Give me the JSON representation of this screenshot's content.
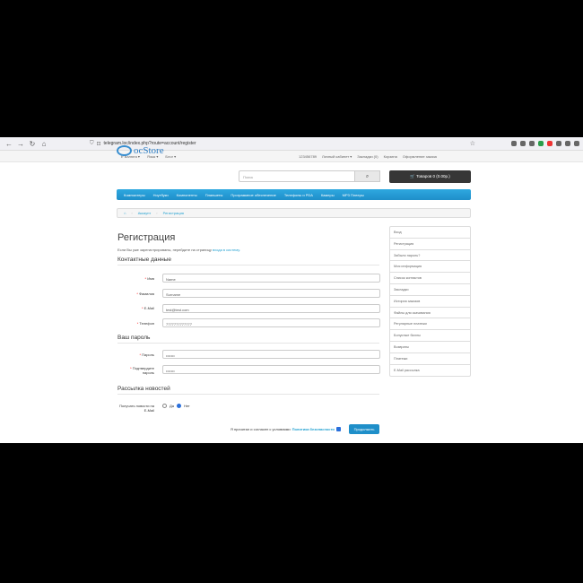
{
  "browser": {
    "url": "telegram.loc/index.php?route=account/register"
  },
  "topbar": {
    "currency": "₽ Валюта ▾",
    "language": "Язык ▾",
    "blog": "Блог ▾",
    "phone": "123456789",
    "account": "Личный кабинет ▾",
    "wishlist": "Закладки (0)",
    "cart": "Корзина",
    "checkout": "Оформление заказа"
  },
  "header": {
    "logo_text": "ocStore",
    "search_placeholder": "Поиск",
    "cart_button": "Товаров 0 (0.00р.)"
  },
  "menu": [
    "Компьютеры",
    "Ноутбуки",
    "Компоненты",
    "Планшеты",
    "Программное обеспечение",
    "Телефоны и PDA",
    "Камеры",
    "MP3 Плееры"
  ],
  "breadcrumb": [
    "Аккаунт",
    "Регистрация"
  ],
  "page": {
    "title": "Регистрация",
    "intro_text": "Если Вы уже зарегистрированы, перейдите на страницу",
    "intro_link": "входа в систему."
  },
  "sections": {
    "contact": "Контактные данные",
    "password": "Ваш пароль",
    "newsletter": "Рассылка новостей"
  },
  "fields": {
    "firstname": {
      "label": "Имя",
      "value": "Name"
    },
    "lastname": {
      "label": "Фамилия",
      "value": "Surname"
    },
    "email": {
      "label": "E-Mail",
      "value": "test@test.com"
    },
    "phone": {
      "label": "Телефон",
      "value": "7777777777777"
    },
    "password": {
      "label": "Пароль",
      "value": "•••••••"
    },
    "confirm": {
      "label": "Подтвердите пароль",
      "value": "•••••••"
    }
  },
  "newsletter": {
    "label": "Получать новости на E-Mail",
    "yes": "Да",
    "no": "Нет"
  },
  "agree": {
    "text": "Я прочитал и согласен с условиями",
    "link": "Политика безопасности"
  },
  "continue_button": "Продолжить",
  "sidebar": [
    "Вход",
    "Регистрация",
    "Забыли пароль?",
    "Моя информация",
    "Список контактов",
    "Закладки",
    "История заказов",
    "Файлы для скачивания",
    "Регулярные платежи",
    "Бонусные баллы",
    "Возвраты",
    "Платежи",
    "E-Mail рассылка"
  ]
}
